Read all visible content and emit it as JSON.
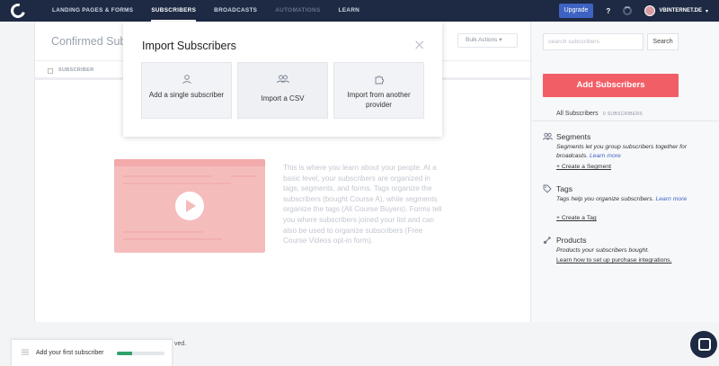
{
  "nav": {
    "items": [
      {
        "label": "LANDING PAGES & FORMS",
        "state": "normal"
      },
      {
        "label": "SUBSCRIBERS",
        "state": "active"
      },
      {
        "label": "BROADCASTS",
        "state": "normal"
      },
      {
        "label": "AUTOMATIONS",
        "state": "dim"
      },
      {
        "label": "LEARN",
        "state": "normal"
      }
    ],
    "upgrade_label": "Upgrade",
    "help_label": "?",
    "account_name": "VBINTERNET.DE",
    "caret": "▾"
  },
  "main": {
    "title": "Confirmed Sub",
    "bulk_label": "Bulk Actions ▾",
    "column_subscriber": "SUBSCRIBER",
    "intro_text": "This is where you learn about your people. At a basic level, your subscribers are organized in tags, segments, and forms. Tags organize the subscribers (bought Course A), while segments organize the tags (All Course Buyers). Forms tell you where subscribers joined your list and can also be used to organize subscribers (Free Course Videos opt-in form)."
  },
  "modal": {
    "title": "Import Subscribers",
    "close": "×",
    "options": [
      {
        "label": "Add a single subscriber",
        "icon": "user-icon"
      },
      {
        "label": "Import a CSV",
        "icon": "users-icon"
      },
      {
        "label": "Import from another provider",
        "icon": "puzzle-icon"
      }
    ]
  },
  "sidebar": {
    "search_placeholder": "search subscribers",
    "search_button": "Search",
    "add_button": "Add Subscribers",
    "all_subscribers": "All Subscribers",
    "subscriber_count": "0 SUBSCRIBERS",
    "segments": {
      "heading": "Segments",
      "desc": "Segments let you group subscribers together for broadcasts.",
      "more": "Learn more",
      "link": "+ Create a Segment"
    },
    "tags": {
      "heading": "Tags",
      "desc": "Tags help you organize subscribers.",
      "more": "Learn more",
      "link": "+ Create a Tag"
    },
    "products": {
      "heading": "Products",
      "desc": "Products your subscribers bought.",
      "link": "Learn how to set up purchase integrations."
    }
  },
  "footer": {
    "checklist_label": "Add your first subscriber",
    "progress": 0.33,
    "saved_fragment": "ved."
  },
  "colors": {
    "nav_bg": "#1e2a44",
    "accent_blue": "#3e63c2",
    "add_button": "#f25e66",
    "progress": "#2fa36b"
  }
}
